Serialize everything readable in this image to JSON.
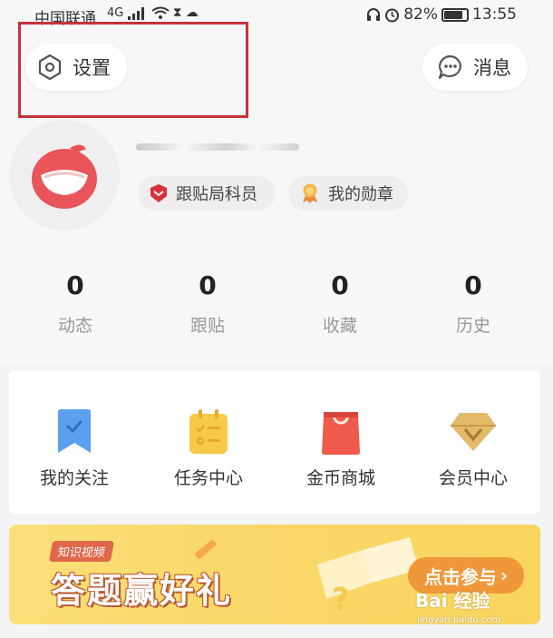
{
  "status_bar": {
    "carrier": "中国联通",
    "network": "4G",
    "battery": "82%",
    "battery_level": 0.82,
    "time": "13:55"
  },
  "header": {
    "settings_label": "设置",
    "messages_label": "消息"
  },
  "profile": {
    "tags": [
      {
        "label": "跟贴局科员",
        "icon": "red-shield-icon"
      },
      {
        "label": "我的勋章",
        "icon": "medal-icon"
      }
    ]
  },
  "stats": [
    {
      "value": "0",
      "label": "动态"
    },
    {
      "value": "0",
      "label": "跟贴"
    },
    {
      "value": "0",
      "label": "收藏"
    },
    {
      "value": "0",
      "label": "历史"
    }
  ],
  "menu": [
    {
      "label": "我的关注",
      "icon": "bookmark-icon"
    },
    {
      "label": "任务中心",
      "icon": "task-clipboard-icon"
    },
    {
      "label": "金币商城",
      "icon": "shopping-bag-icon"
    },
    {
      "label": "会员中心",
      "icon": "vip-diamond-icon"
    }
  ],
  "banner": {
    "tag": "知识视频",
    "title": "答题赢好礼",
    "cta": "点击参与",
    "cta_arrow": "›"
  },
  "watermark": {
    "text": "Bai 经验",
    "sub": "jingyan.baidu.com"
  },
  "colors": {
    "highlight_box": "#c8323a",
    "banner_bg": "#fad86a",
    "cta_bg": "#f0973a",
    "avatar_red": "#e8555a"
  }
}
